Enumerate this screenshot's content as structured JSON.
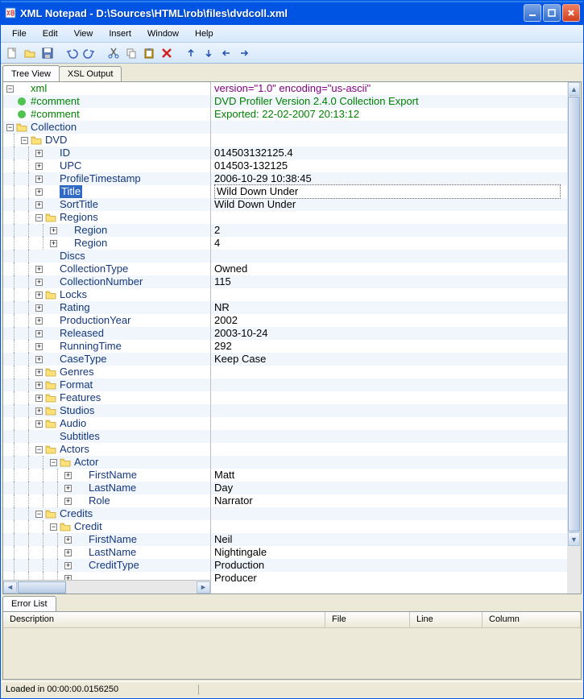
{
  "window": {
    "title": "XML Notepad - D:\\Sources\\HTML\\rob\\files\\dvdcoll.xml"
  },
  "menu": [
    "File",
    "Edit",
    "View",
    "Insert",
    "Window",
    "Help"
  ],
  "tabs": {
    "tree": "Tree View",
    "xsl": "XSL Output"
  },
  "error_tab": "Error List",
  "error_headers": {
    "desc": "Description",
    "file": "File",
    "line": "Line",
    "col": "Column"
  },
  "status": "Loaded in 00:00:00.0156250",
  "rows": [
    {
      "ind": 0,
      "exp": "-",
      "icon": "xml",
      "name": "xml",
      "val": "version=\"1.0\" encoding=\"us-ascii\"",
      "vclass": "val-xml",
      "alt": false
    },
    {
      "ind": 0,
      "exp": " ",
      "icon": "green",
      "name": "#comment",
      "val": "DVD Profiler Version 2.4.0 Collection Export",
      "vclass": "val-comment",
      "alt": true
    },
    {
      "ind": 0,
      "exp": " ",
      "icon": "green",
      "name": "#comment",
      "val": "Exported: 22-02-2007 20:13:12",
      "vclass": "val-comment",
      "alt": false
    },
    {
      "ind": 0,
      "exp": "-",
      "icon": "folder",
      "name": "Collection",
      "val": "",
      "vclass": "val-text",
      "alt": true
    },
    {
      "ind": 1,
      "exp": "-",
      "icon": "folder",
      "name": "DVD",
      "val": "",
      "vclass": "val-text",
      "alt": false
    },
    {
      "ind": 2,
      "exp": "+",
      "icon": "element",
      "name": "ID",
      "val": "014503132125.4",
      "vclass": "val-text",
      "alt": true
    },
    {
      "ind": 2,
      "exp": "+",
      "icon": "element",
      "name": "UPC",
      "val": "014503-132125",
      "vclass": "val-text",
      "alt": false
    },
    {
      "ind": 2,
      "exp": "+",
      "icon": "element",
      "name": "ProfileTimestamp",
      "val": "2006-10-29 10:38:45",
      "vclass": "val-text",
      "alt": true
    },
    {
      "ind": 2,
      "exp": "+",
      "icon": "element",
      "name": "Title",
      "val": "Wild Down Under",
      "vclass": "val-text",
      "alt": false,
      "selected": true
    },
    {
      "ind": 2,
      "exp": "+",
      "icon": "element",
      "name": "SortTitle",
      "val": "Wild Down Under",
      "vclass": "val-text",
      "alt": true
    },
    {
      "ind": 2,
      "exp": "-",
      "icon": "folder",
      "name": "Regions",
      "val": "",
      "vclass": "val-text",
      "alt": false
    },
    {
      "ind": 3,
      "exp": "+",
      "icon": "element",
      "name": "Region",
      "val": "2",
      "vclass": "val-text",
      "alt": true
    },
    {
      "ind": 3,
      "exp": "+",
      "icon": "element",
      "name": "Region",
      "val": "4",
      "vclass": "val-text",
      "alt": false
    },
    {
      "ind": 2,
      "exp": " ",
      "icon": "element",
      "name": "Discs",
      "val": "",
      "vclass": "val-text",
      "alt": true
    },
    {
      "ind": 2,
      "exp": "+",
      "icon": "element",
      "name": "CollectionType",
      "val": "Owned",
      "vclass": "val-text",
      "alt": false
    },
    {
      "ind": 2,
      "exp": "+",
      "icon": "element",
      "name": "CollectionNumber",
      "val": "115",
      "vclass": "val-text",
      "alt": true
    },
    {
      "ind": 2,
      "exp": "+",
      "icon": "folder",
      "name": "Locks",
      "val": "",
      "vclass": "val-text",
      "alt": false
    },
    {
      "ind": 2,
      "exp": "+",
      "icon": "element",
      "name": "Rating",
      "val": "NR",
      "vclass": "val-text",
      "alt": true
    },
    {
      "ind": 2,
      "exp": "+",
      "icon": "element",
      "name": "ProductionYear",
      "val": "2002",
      "vclass": "val-text",
      "alt": false
    },
    {
      "ind": 2,
      "exp": "+",
      "icon": "element",
      "name": "Released",
      "val": "2003-10-24",
      "vclass": "val-text",
      "alt": true
    },
    {
      "ind": 2,
      "exp": "+",
      "icon": "element",
      "name": "RunningTime",
      "val": "292",
      "vclass": "val-text",
      "alt": false
    },
    {
      "ind": 2,
      "exp": "+",
      "icon": "element",
      "name": "CaseType",
      "val": "Keep Case",
      "vclass": "val-text",
      "alt": true
    },
    {
      "ind": 2,
      "exp": "+",
      "icon": "folder",
      "name": "Genres",
      "val": "",
      "vclass": "val-text",
      "alt": false
    },
    {
      "ind": 2,
      "exp": "+",
      "icon": "folder",
      "name": "Format",
      "val": "",
      "vclass": "val-text",
      "alt": true
    },
    {
      "ind": 2,
      "exp": "+",
      "icon": "folder",
      "name": "Features",
      "val": "",
      "vclass": "val-text",
      "alt": false
    },
    {
      "ind": 2,
      "exp": "+",
      "icon": "folder",
      "name": "Studios",
      "val": "",
      "vclass": "val-text",
      "alt": true
    },
    {
      "ind": 2,
      "exp": "+",
      "icon": "folder",
      "name": "Audio",
      "val": "",
      "vclass": "val-text",
      "alt": false
    },
    {
      "ind": 2,
      "exp": " ",
      "icon": "element",
      "name": "Subtitles",
      "val": "",
      "vclass": "val-text",
      "alt": true
    },
    {
      "ind": 2,
      "exp": "-",
      "icon": "folder",
      "name": "Actors",
      "val": "",
      "vclass": "val-text",
      "alt": false
    },
    {
      "ind": 3,
      "exp": "-",
      "icon": "folder",
      "name": "Actor",
      "val": "",
      "vclass": "val-text",
      "alt": true
    },
    {
      "ind": 4,
      "exp": "+",
      "icon": "element",
      "name": "FirstName",
      "val": "Matt",
      "vclass": "val-text",
      "alt": false
    },
    {
      "ind": 4,
      "exp": "+",
      "icon": "element",
      "name": "LastName",
      "val": "Day",
      "vclass": "val-text",
      "alt": true
    },
    {
      "ind": 4,
      "exp": "+",
      "icon": "element",
      "name": "Role",
      "val": "Narrator",
      "vclass": "val-text",
      "alt": false
    },
    {
      "ind": 2,
      "exp": "-",
      "icon": "folder",
      "name": "Credits",
      "val": "",
      "vclass": "val-text",
      "alt": true
    },
    {
      "ind": 3,
      "exp": "-",
      "icon": "folder",
      "name": "Credit",
      "val": "",
      "vclass": "val-text",
      "alt": false
    },
    {
      "ind": 4,
      "exp": "+",
      "icon": "element",
      "name": "FirstName",
      "val": "Neil",
      "vclass": "val-text",
      "alt": true
    },
    {
      "ind": 4,
      "exp": "+",
      "icon": "element",
      "name": "LastName",
      "val": "Nightingale",
      "vclass": "val-text",
      "alt": false
    },
    {
      "ind": 4,
      "exp": "+",
      "icon": "element",
      "name": "CreditType",
      "val": "Production",
      "vclass": "val-text",
      "alt": true
    },
    {
      "ind": 4,
      "exp": "+",
      "icon": "element",
      "name": "",
      "val": "Producer",
      "vclass": "val-text",
      "alt": false
    }
  ]
}
